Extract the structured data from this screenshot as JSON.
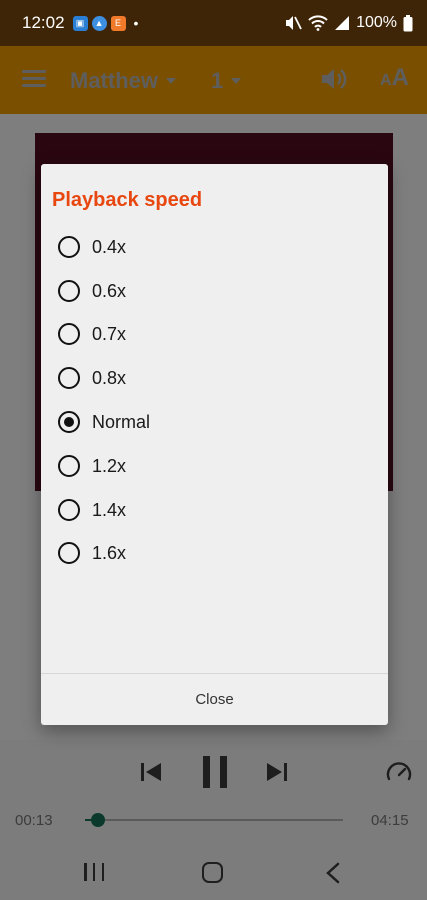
{
  "status_bar": {
    "time": "12:02",
    "notifications": [
      {
        "icon": "app-notification-icon-blue",
        "color": "#2a7fd4"
      },
      {
        "icon": "app-notification-icon-lightblue",
        "color": "#3d8fe0"
      },
      {
        "icon": "app-notification-icon-orange",
        "color": "#f07a2a"
      }
    ],
    "dot": "•",
    "battery": "100%"
  },
  "app_bar": {
    "book": "Matthew",
    "chapter": "1"
  },
  "player": {
    "current_time": "00:13",
    "total_time": "04:15",
    "progress": 0.05
  },
  "dialog": {
    "title": "Playback speed",
    "options": [
      "0.4x",
      "0.6x",
      "0.7x",
      "0.8x",
      "Normal",
      "1.2x",
      "1.4x",
      "1.6x"
    ],
    "selected": "Normal",
    "close_label": "Close"
  },
  "colors": {
    "status_bar": "#3f2507",
    "app_bar": "#7a5000",
    "dialog_title": "#e8470f",
    "seek_accent": "#0b3a2c"
  }
}
